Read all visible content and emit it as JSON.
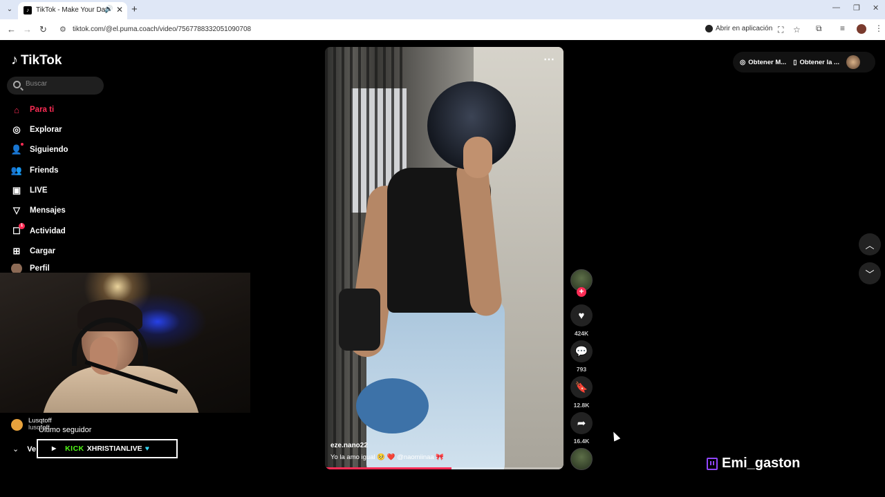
{
  "browser": {
    "tab_title": "TikTok - Make Your Day",
    "url": "tiktok.com/@el.puma.coach/video/7567788332051090708",
    "open_in_app": "Abrir en aplicación"
  },
  "sidebar": {
    "logo": "TikTok",
    "search_placeholder": "Buscar",
    "items": [
      {
        "label": "Para ti",
        "icon": "home-icon"
      },
      {
        "label": "Explorar",
        "icon": "compass-icon"
      },
      {
        "label": "Siguiendo",
        "icon": "user-follow-icon"
      },
      {
        "label": "Friends",
        "icon": "friends-icon"
      },
      {
        "label": "LIVE",
        "icon": "live-icon"
      },
      {
        "label": "Mensajes",
        "icon": "send-icon"
      },
      {
        "label": "Actividad",
        "icon": "activity-icon",
        "badge": "1"
      },
      {
        "label": "Cargar",
        "icon": "upload-icon"
      },
      {
        "label": "Perfil",
        "icon": "profile-avatar"
      }
    ]
  },
  "stream_overlay": {
    "follower_name": "Lusqtoff",
    "follower_handle": "lusqtoff",
    "last_follower_label": "Último seguidor",
    "see_more_label": "Ve",
    "kick_logo": "KICK",
    "kick_channel": "XHRISTIANLIVE",
    "twitch_name": "Emi_gaston"
  },
  "video": {
    "author": "eze.nano22",
    "caption": "Yo la amo igual 🥺 ❤️ @naomiinaa 🎀",
    "progress": 0.53
  },
  "actions": {
    "likes": "424K",
    "comments": "793",
    "saves": "12.8K",
    "shares": "16.4K"
  },
  "top_right": {
    "get_coins": "Obtener M...",
    "get_app": "Obtener la ..."
  },
  "colors": {
    "accent": "#fe2c55",
    "kick": "#53fc18",
    "twitch": "#9146ff"
  }
}
